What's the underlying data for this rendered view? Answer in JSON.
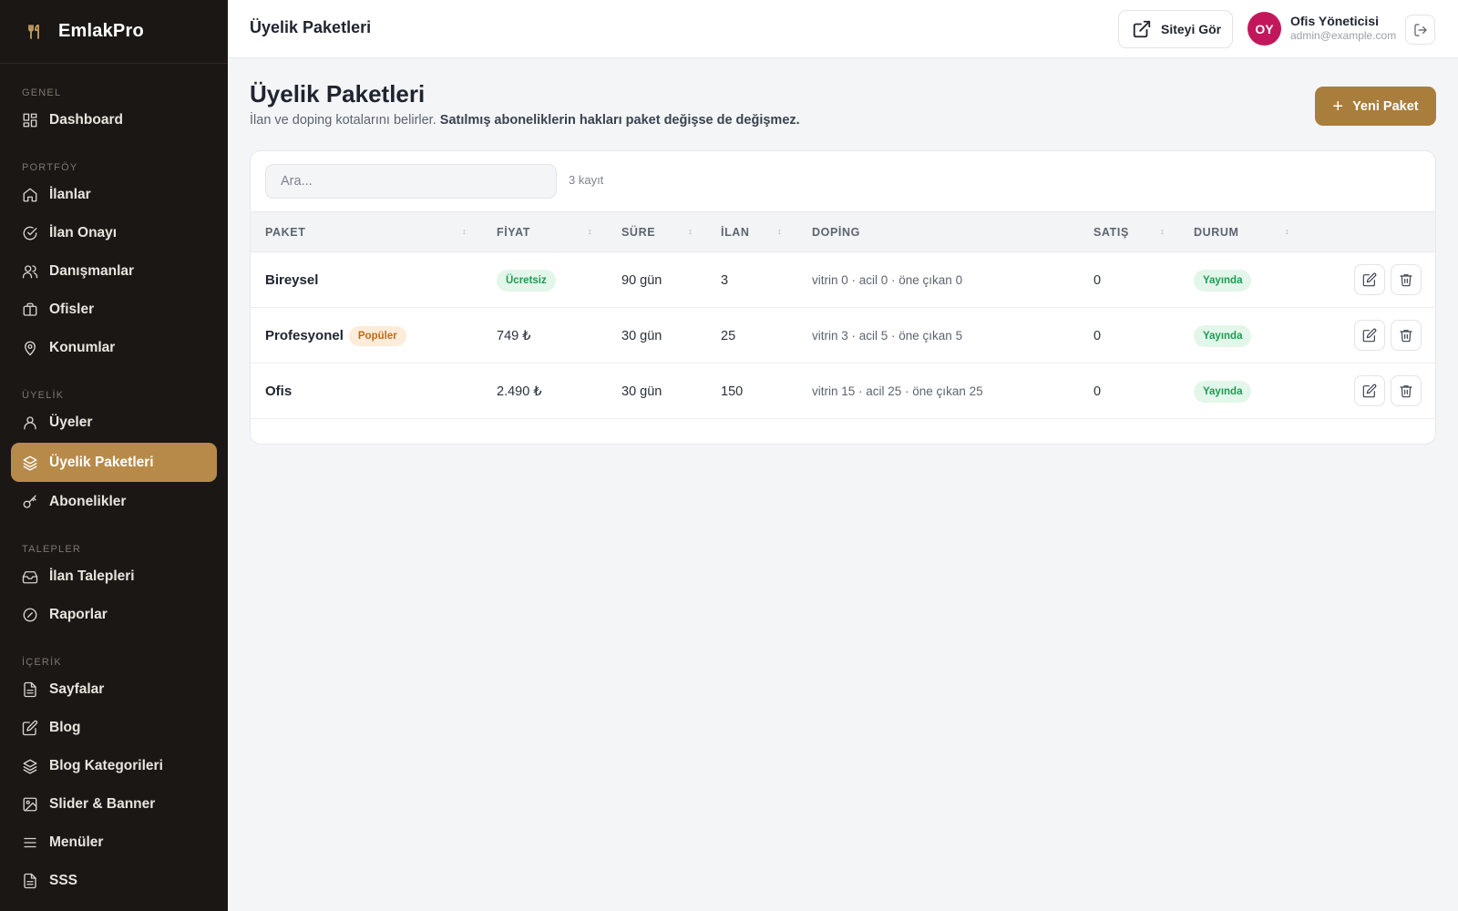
{
  "app": {
    "brand": "EmlakPro"
  },
  "sidebar": {
    "sections": [
      {
        "title": "GENEL",
        "items": [
          {
            "label": "Dashboard",
            "icon": "dashboard-icon"
          }
        ]
      },
      {
        "title": "PORTFÖY",
        "items": [
          {
            "label": "İlanlar",
            "icon": "home-icon"
          },
          {
            "label": "İlan Onayı",
            "icon": "check-circle-icon"
          },
          {
            "label": "Danışmanlar",
            "icon": "users-icon"
          },
          {
            "label": "Ofisler",
            "icon": "briefcase-icon"
          },
          {
            "label": "Konumlar",
            "icon": "map-pin-icon"
          }
        ]
      },
      {
        "title": "ÜYELİK",
        "items": [
          {
            "label": "Üyeler",
            "icon": "user-icon"
          },
          {
            "label": "Üyelik Paketleri",
            "icon": "layers-icon",
            "active": true
          },
          {
            "label": "Abonelikler",
            "icon": "key-icon"
          }
        ]
      },
      {
        "title": "TALEPLER",
        "items": [
          {
            "label": "İlan Talepleri",
            "icon": "inbox-icon"
          },
          {
            "label": "Raporlar",
            "icon": "alert-circle-icon"
          }
        ]
      },
      {
        "title": "İÇERİK",
        "items": [
          {
            "label": "Sayfalar",
            "icon": "file-icon"
          },
          {
            "label": "Blog",
            "icon": "edit-icon"
          },
          {
            "label": "Blog Kategorileri",
            "icon": "layers-icon"
          },
          {
            "label": "Slider & Banner",
            "icon": "image-icon"
          },
          {
            "label": "Menüler",
            "icon": "menu-icon"
          },
          {
            "label": "SSS",
            "icon": "file-icon"
          }
        ]
      }
    ]
  },
  "topbar": {
    "title": "Üyelik Paketleri",
    "site_button": "Siteyi Gör",
    "user": {
      "initials": "OY",
      "name": "Ofis Yöneticisi",
      "email": "admin@example.com"
    }
  },
  "page": {
    "title": "Üyelik Paketleri",
    "description": "İlan ve doping kotalarını belirler.",
    "description_bold": "Satılmış aboneliklerin hakları paket değişse de değişmez.",
    "new_button": "Yeni Paket"
  },
  "table": {
    "search_placeholder": "Ara...",
    "record_count": "3 kayıt",
    "columns": [
      "PAKET",
      "FİYAT",
      "SÜRE",
      "İLAN",
      "DOPİNG",
      "SATIŞ",
      "DURUM"
    ],
    "rows": [
      {
        "name": "Bireysel",
        "badge": "",
        "price": "Ücretsiz",
        "price_is_badge": true,
        "duration": "90 gün",
        "listings": "3",
        "doping": "vitrin 0 · acil 0 · öne çıkan 0",
        "sales": "0",
        "status": "Yayında"
      },
      {
        "name": "Profesyonel",
        "badge": "Popüler",
        "price": "749 ₺",
        "price_is_badge": false,
        "duration": "30 gün",
        "listings": "25",
        "doping": "vitrin 3 · acil 5 · öne çıkan 5",
        "sales": "0",
        "status": "Yayında"
      },
      {
        "name": "Ofis",
        "badge": "",
        "price": "2.490 ₺",
        "price_is_badge": false,
        "duration": "30 gün",
        "listings": "150",
        "doping": "vitrin 15 · acil 25 · öne çıkan 25",
        "sales": "0",
        "status": "Yayında"
      }
    ]
  },
  "colors": {
    "accent": "#b88a49",
    "sidebar_bg": "#1a1714",
    "success": "#1f9a53",
    "avatar": "#c2185b"
  }
}
